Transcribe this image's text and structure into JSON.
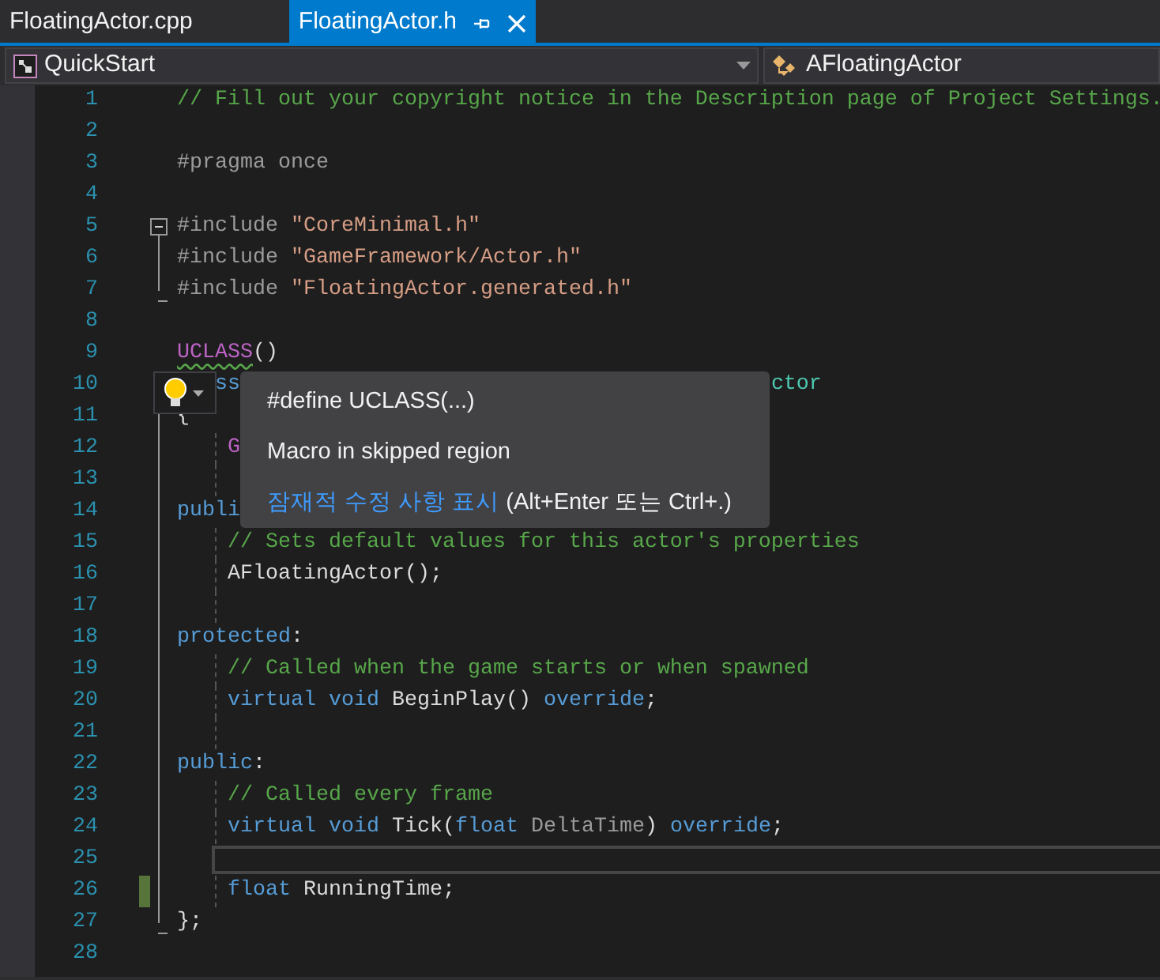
{
  "tabs": [
    {
      "label": "FloatingActor.cpp",
      "selected": false
    },
    {
      "label": "FloatingActor.h",
      "selected": true
    }
  ],
  "navigation": {
    "project": "QuickStart",
    "member": "AFloatingActor"
  },
  "editor": {
    "lines": [
      {
        "number": "1",
        "tokens": [
          {
            "text": "// Fill out your copyright notice in the Description page of Project Settings.",
            "kind": "comment"
          }
        ]
      },
      {
        "number": "2"
      },
      {
        "number": "3",
        "tokens": [
          {
            "text": "#pragma once",
            "kind": "preproc"
          }
        ]
      },
      {
        "number": "4"
      },
      {
        "number": "5",
        "kind": "start",
        "expanded": true,
        "tokens": [
          {
            "text": "#include",
            "kind": "preproc"
          },
          {
            "text": " \"CoreMinimal.h\"",
            "kind": "string"
          }
        ]
      },
      {
        "number": "6",
        "kind": "inside",
        "tokens": [
          {
            "text": "#include",
            "kind": "preproc"
          },
          {
            "text": " \"GameFramework/Actor.h\"",
            "kind": "string"
          }
        ]
      },
      {
        "number": "7",
        "kind": "end",
        "tokens": [
          {
            "text": "#include",
            "kind": "preproc"
          },
          {
            "text": " \"FloatingActor.generated.h\"",
            "kind": "string"
          }
        ]
      },
      {
        "number": "8"
      },
      {
        "number": "9",
        "tokens": [
          {
            "text": "UCLASS",
            "kind": "macro",
            "squiggle": true
          },
          {
            "text": "()",
            "kind": "plain"
          }
        ]
      },
      {
        "number": "10",
        "tokens": [
          {
            "text": "   ss",
            "kind": "keyword"
          },
          {
            "text": "                                          ctor",
            "kind": "type"
          }
        ]
      },
      {
        "number": "11",
        "kind": "inside",
        "tokens": [
          {
            "text": "{",
            "kind": "plain"
          }
        ]
      },
      {
        "number": "12",
        "kind": "inside",
        "tokens": [
          {
            "text": "    G",
            "kind": "macro"
          }
        ]
      },
      {
        "number": "13",
        "kind": "inside"
      },
      {
        "number": "14",
        "kind": "inside",
        "tokens": [
          {
            "text": "publi",
            "kind": "keyword"
          }
        ]
      },
      {
        "number": "15",
        "kind": "inside",
        "tokens": [
          {
            "text": "    // Sets default values for this actor's properties",
            "kind": "comment"
          }
        ]
      },
      {
        "number": "16",
        "kind": "inside",
        "tokens": [
          {
            "text": "    AFloatingActor();",
            "kind": "plain"
          }
        ]
      },
      {
        "number": "17",
        "kind": "inside"
      },
      {
        "number": "18",
        "kind": "inside",
        "tokens": [
          {
            "text": "protected",
            "kind": "keyword"
          },
          {
            "text": ":",
            "kind": "plain"
          }
        ]
      },
      {
        "number": "19",
        "kind": "inside",
        "tokens": [
          {
            "text": "    // Called when the game starts or when spawned",
            "kind": "comment"
          }
        ]
      },
      {
        "number": "20",
        "kind": "inside",
        "tokens": [
          {
            "text": "    virtual void",
            "kind": "keyword"
          },
          {
            "text": " BeginPlay()",
            "kind": "plain"
          },
          {
            "text": " override",
            "kind": "keyword"
          },
          {
            "text": ";",
            "kind": "plain"
          }
        ]
      },
      {
        "number": "21",
        "kind": "inside"
      },
      {
        "number": "22",
        "kind": "inside",
        "tokens": [
          {
            "text": "public",
            "kind": "keyword"
          },
          {
            "text": ":",
            "kind": "plain"
          }
        ]
      },
      {
        "number": "23",
        "kind": "inside",
        "tokens": [
          {
            "text": "    // Called every frame",
            "kind": "comment"
          }
        ]
      },
      {
        "number": "24",
        "kind": "inside",
        "tokens": [
          {
            "text": "    virtual void",
            "kind": "keyword"
          },
          {
            "text": " Tick(",
            "kind": "plain"
          },
          {
            "text": "float",
            "kind": "keyword"
          },
          {
            "text": " DeltaTime",
            "kind": "param"
          },
          {
            "text": ")",
            "kind": "plain"
          },
          {
            "text": " override",
            "kind": "keyword"
          },
          {
            "text": ";",
            "kind": "plain"
          }
        ]
      },
      {
        "number": "25",
        "kind": "inside",
        "current": true
      },
      {
        "number": "26",
        "kind": "inside",
        "changed": true,
        "tokens": [
          {
            "text": "    float",
            "kind": "keyword"
          },
          {
            "text": " RunningTime;",
            "kind": "plain"
          }
        ]
      },
      {
        "number": "27",
        "kind": "end",
        "tokens": [
          {
            "text": "};",
            "kind": "plain"
          }
        ]
      },
      {
        "number": "28"
      }
    ]
  },
  "quick_actions": {
    "items": [
      {
        "kind": "text",
        "text": "#define UCLASS(...)"
      },
      {
        "kind": "text",
        "text": "Macro in skipped region"
      },
      {
        "kind": "link",
        "link": "잠재적 수정 사항 표시",
        "text": " (Alt+Enter 또는 Ctrl+.)"
      }
    ]
  }
}
